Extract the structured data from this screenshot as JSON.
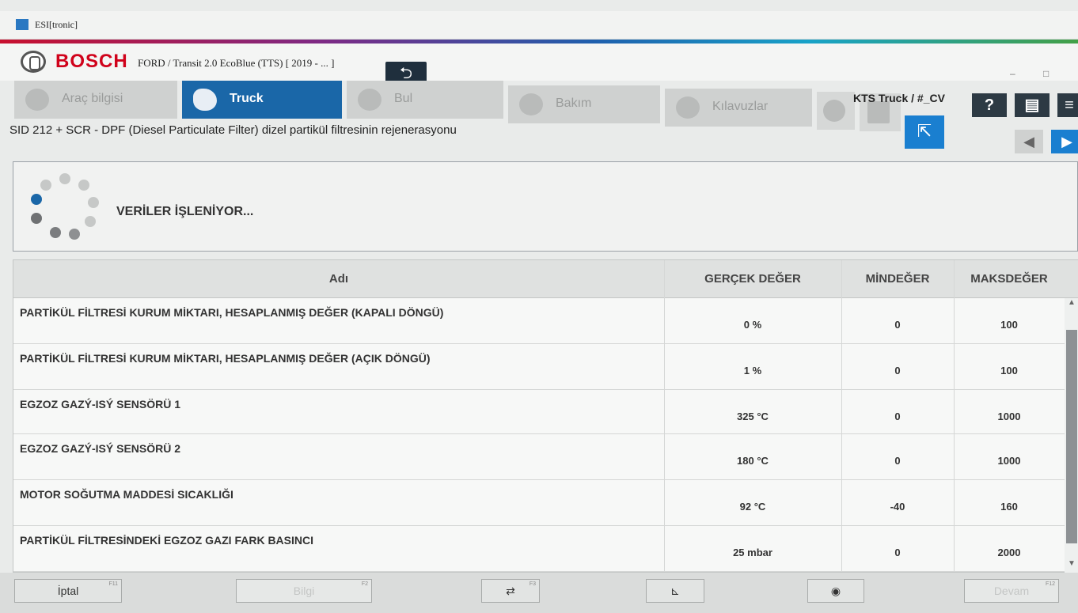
{
  "window": {
    "title": "ESI[tronic]",
    "minimize": "–",
    "restore": "□"
  },
  "header": {
    "brand": "BOSCH",
    "vehicle": "FORD / Transit 2.0 EcoBlue (TTS) [ 2019 - ... ]",
    "back_icon": "undo-arrow-icon",
    "user": "KTS Truck / #_CV"
  },
  "tabs": [
    {
      "label": "Araç bilgisi",
      "icon": "car-info-icon"
    },
    {
      "label": "Truck",
      "icon": "truck-icon"
    },
    {
      "label": "Bul",
      "icon": "search-icon"
    },
    {
      "label": "Bakım",
      "icon": "gears-icon"
    },
    {
      "label": "Kılavuzlar",
      "icon": "wrench-icon"
    }
  ],
  "toolbar": {
    "help": "?",
    "print_icon": "printer-icon",
    "external_icon": "external-link-icon",
    "prev": "◀",
    "next": "▶"
  },
  "breadcrumb": "SID 212 + SCR - DPF (Diesel Particulate Filter) dizel partikül filtresinin rejenerasyonu",
  "status": {
    "text": "VERİLER İŞLENİYOR..."
  },
  "table": {
    "columns": [
      "Adı",
      "GERÇEK DEĞER",
      "MİNDEĞER",
      "MAKSDEĞER"
    ],
    "rows": [
      {
        "name": "PARTİKÜL FİLTRESİ KURUM MİKTARI, HESAPLANMIŞ DEĞER (KAPALI DÖNGÜ)",
        "actual": "0 %",
        "min": "0",
        "max": "100"
      },
      {
        "name": "PARTİKÜL FİLTRESİ KURUM MİKTARI, HESAPLANMIŞ DEĞER (AÇIK DÖNGÜ)",
        "actual": "1 %",
        "min": "0",
        "max": "100"
      },
      {
        "name": "EGZOZ GAZÝ-ISÝ SENSÖRÜ 1",
        "actual": "325 °C",
        "min": "0",
        "max": "1000"
      },
      {
        "name": "EGZOZ GAZÝ-ISÝ SENSÖRÜ 2",
        "actual": "180 °C",
        "min": "0",
        "max": "1000"
      },
      {
        "name": "MOTOR SOĞUTMA MADDESİ SICAKLIĞI",
        "actual": "92 °C",
        "min": "-40",
        "max": "160"
      },
      {
        "name": "PARTİKÜL FİLTRESİNDEKİ EGZOZ GAZI FARK BASINCI",
        "actual": "25 mbar",
        "min": "0",
        "max": "2000"
      }
    ]
  },
  "footer": {
    "cancel": "İptal",
    "cancel_key": "F11",
    "info": "Bilgi",
    "info_key": "F2",
    "arrows_key": "F3",
    "continue": "Devam",
    "continue_key": "F12"
  },
  "colors": {
    "accent": "#1a67a8",
    "brand_red": "#d0021b",
    "dark_button": "#2d3a44"
  }
}
